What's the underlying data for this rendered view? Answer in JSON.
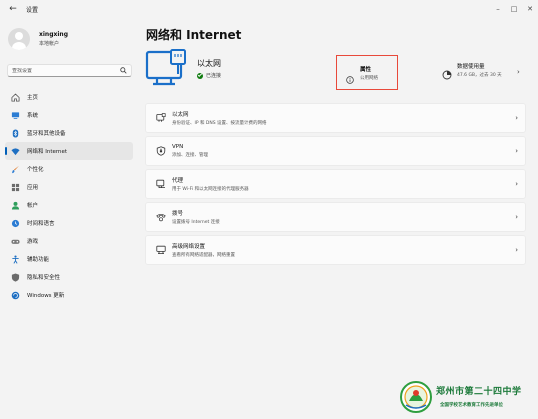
{
  "window": {
    "title": "设置",
    "controls": [
      "minimize",
      "maximize",
      "close"
    ]
  },
  "user": {
    "name": "xingxing",
    "account_type": "本地帐户"
  },
  "search": {
    "placeholder": "查找设置"
  },
  "sidebar": {
    "items": [
      {
        "label": "主页",
        "icon": "home-icon"
      },
      {
        "label": "系统",
        "icon": "system-icon"
      },
      {
        "label": "蓝牙和其他设备",
        "icon": "bluetooth-icon"
      },
      {
        "label": "网络和 Internet",
        "icon": "wifi-icon",
        "active": true
      },
      {
        "label": "个性化",
        "icon": "brush-icon"
      },
      {
        "label": "应用",
        "icon": "apps-icon"
      },
      {
        "label": "帐户",
        "icon": "account-icon"
      },
      {
        "label": "时间和语言",
        "icon": "globe-clock-icon"
      },
      {
        "label": "游戏",
        "icon": "gamepad-icon"
      },
      {
        "label": "辅助功能",
        "icon": "accessibility-icon"
      },
      {
        "label": "隐私和安全性",
        "icon": "shield-icon"
      },
      {
        "label": "Windows 更新",
        "icon": "update-icon"
      }
    ]
  },
  "page": {
    "title": "网络和 Internet"
  },
  "hero": {
    "name": "以太网",
    "status": "已连接",
    "properties": {
      "title": "属性",
      "subtitle": "公用网络"
    },
    "usage": {
      "title": "数据使用量",
      "subtitle": "47.6 GB，过去 30 天"
    }
  },
  "list": [
    {
      "title": "以太网",
      "subtitle": "身份验证、IP 和 DNS 设置、按流量计费的网络",
      "icon": "ethernet-icon"
    },
    {
      "title": "VPN",
      "subtitle": "添加、连接、管理",
      "icon": "vpn-shield-icon"
    },
    {
      "title": "代理",
      "subtitle": "用于 Wi-Fi 和以太网连接的代理服务器",
      "icon": "proxy-icon"
    },
    {
      "title": "拨号",
      "subtitle": "设置拨号 Internet 连接",
      "icon": "dialup-icon"
    },
    {
      "title": "高级网络设置",
      "subtitle": "查看所有网络适配器，网络重置",
      "icon": "network-adapter-icon"
    }
  ],
  "watermark": {
    "name": "郑州市第二十四中学",
    "subtitle": "全国学校艺术教育工作先进单位"
  },
  "colors": {
    "accent": "#005fb8",
    "highlight_border": "#e8493a",
    "logo_green": "#1c7a3a"
  }
}
